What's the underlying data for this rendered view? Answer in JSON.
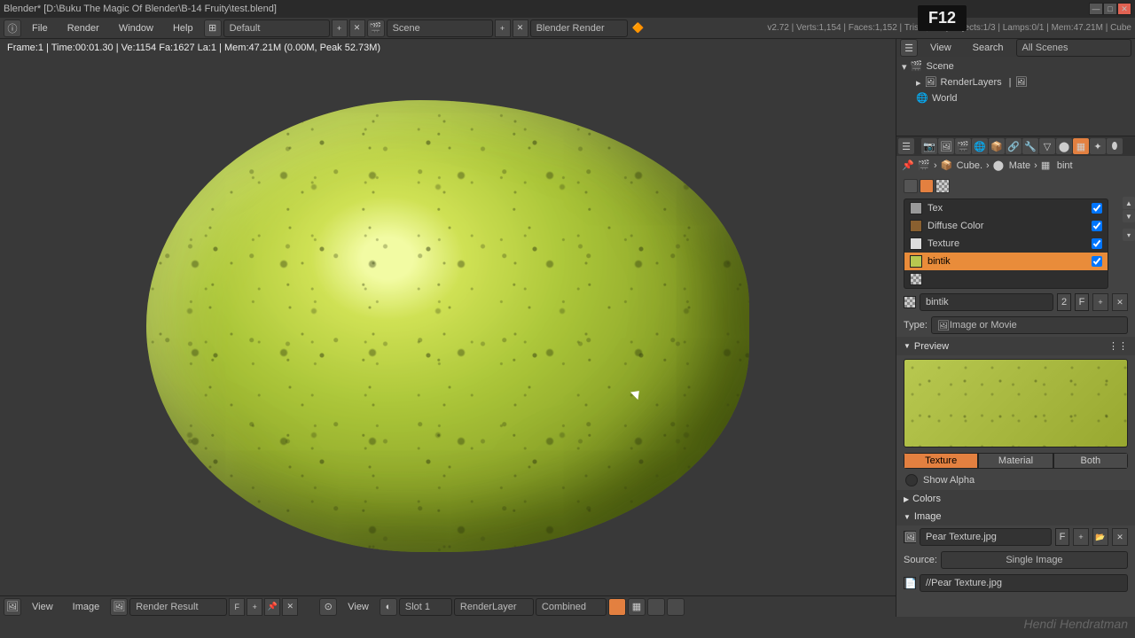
{
  "window": {
    "title": "Blender* [D:\\Buku The Magic Of Blender\\B-14 Fruity\\test.blend]",
    "key_hint": "F12"
  },
  "topmenu": {
    "file": "File",
    "render": "Render",
    "window": "Window",
    "help": "Help",
    "layout_name": "Default",
    "scene_name": "Scene",
    "engine": "Blender Render",
    "stats": "v2.72 | Verts:1,154 | Faces:1,152 | Tris:2,304 | Objects:1/3 | Lamps:0/1 | Mem:47.21M | Cube"
  },
  "render_info": "Frame:1 | Time:00:01.30 | Ve:1154 Fa:1627 La:1 | Mem:47.21M (0.00M, Peak 52.73M)",
  "bottom": {
    "view": "View",
    "image": "Image",
    "render_result": "Render Result",
    "f": "F",
    "view2": "View",
    "slot": "Slot 1",
    "layer": "RenderLayer",
    "pass": "Combined"
  },
  "outliner": {
    "header": {
      "view": "View",
      "search": "Search",
      "filter": "All Scenes"
    },
    "items": {
      "scene": "Scene",
      "renderlayers": "RenderLayers",
      "world": "World"
    }
  },
  "breadcrumb": {
    "cube": "Cube.",
    "mate": "Mate",
    "bint": "bint"
  },
  "textures": {
    "slots": [
      {
        "name": "Tex",
        "color": "#999"
      },
      {
        "name": "Diffuse Color",
        "color": "#8a6030"
      },
      {
        "name": "Texture",
        "color": "#ccc"
      },
      {
        "name": "bintik",
        "color": "#b8c850"
      }
    ],
    "name_field": "bintik",
    "users": "2",
    "f": "F",
    "type_label": "Type:",
    "type_value": "Image or Movie"
  },
  "panels": {
    "preview": "Preview",
    "tabs": {
      "texture": "Texture",
      "material": "Material",
      "both": "Both"
    },
    "show_alpha": "Show Alpha",
    "colors": "Colors",
    "image": "Image",
    "image_name": "Pear Texture.jpg",
    "image_f": "F",
    "source_label": "Source:",
    "source_value": "Single Image",
    "path": "//Pear Texture.jpg"
  }
}
